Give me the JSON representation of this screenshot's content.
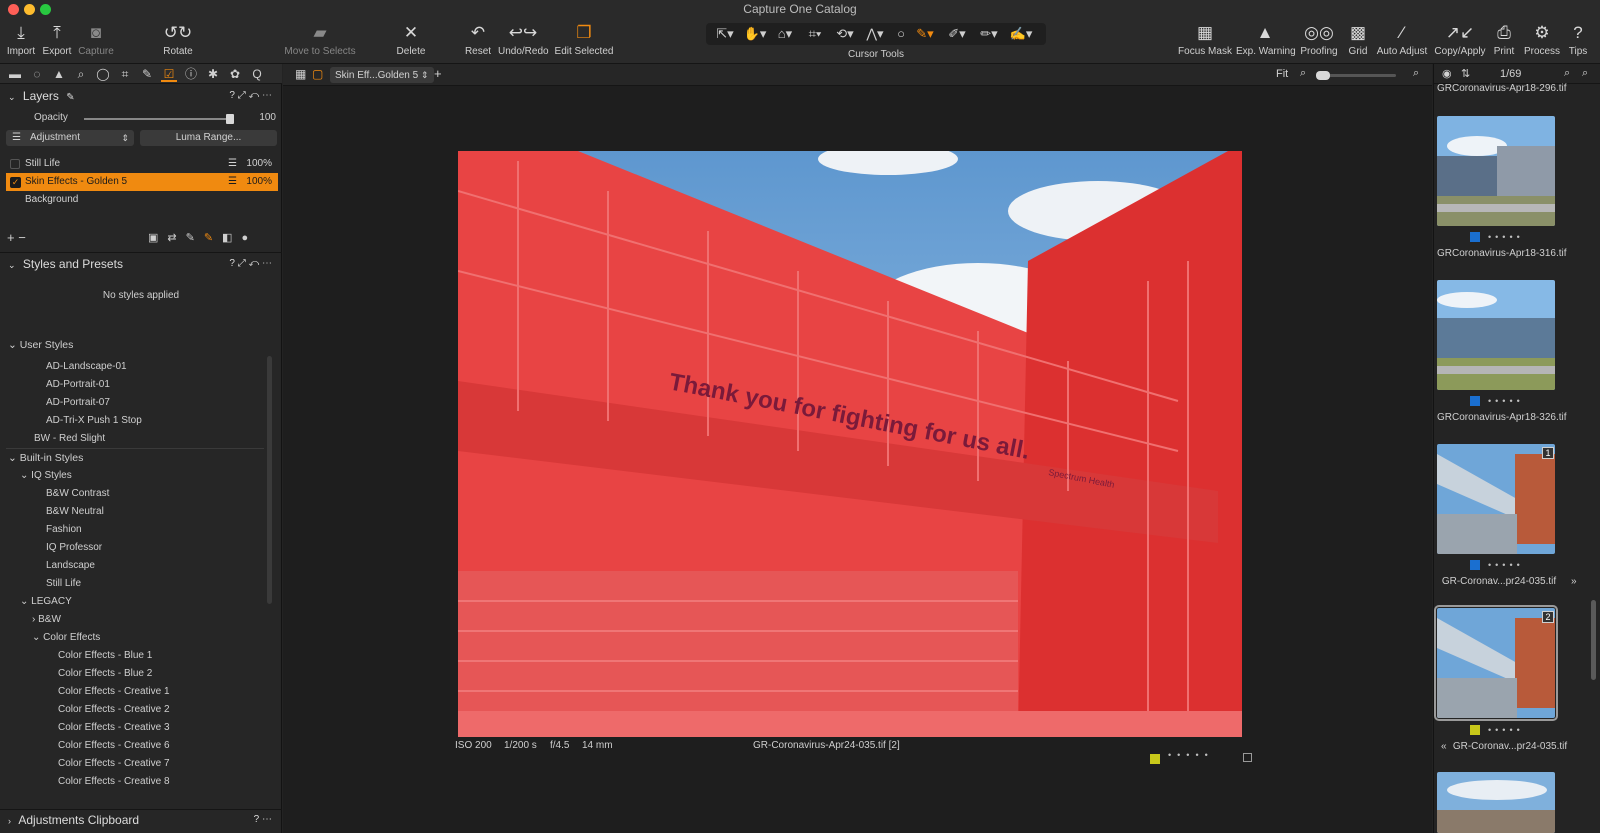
{
  "window": {
    "title": "Capture One Catalog"
  },
  "toolbar": {
    "import": "Import",
    "export": "Export",
    "capture": "Capture",
    "rotate": "Rotate",
    "move_to_selects": "Move to Selects",
    "delete": "Delete",
    "reset": "Reset",
    "undo_redo": "Undo/Redo",
    "edit_selected": "Edit Selected",
    "cursor_tools": "Cursor Tools",
    "focus_mask": "Focus Mask",
    "exp_warning": "Exp. Warning",
    "proofing": "Proofing",
    "grid": "Grid",
    "auto_adjust": "Auto Adjust",
    "copy_apply": "Copy/Apply",
    "print": "Print",
    "process": "Process",
    "tips": "Tips"
  },
  "layers": {
    "title": "Layers",
    "opacity_label": "Opacity",
    "opacity_value": "100",
    "opacity_fraction": 1.0,
    "mode": "Adjustment",
    "luma_button": "Luma Range...",
    "items": [
      {
        "name": "Still Life",
        "value": "100%"
      },
      {
        "name": "Skin Effects - Golden 5",
        "value": "100%"
      },
      {
        "name": "Background",
        "value": ""
      }
    ]
  },
  "styles": {
    "title": "Styles and Presets",
    "empty": "No styles applied",
    "user_styles": "User Styles",
    "user_items": [
      "AD-Landscape-01",
      "AD-Portrait-01",
      "AD-Portrait-07",
      "AD-Tri-X Push 1 Stop",
      "BW - Red Slight"
    ],
    "builtin": "Built-in Styles",
    "iq": "IQ Styles",
    "iq_items": [
      "B&W Contrast",
      "B&W Neutral",
      "Fashion",
      "IQ Professor",
      "Landscape",
      "Still Life"
    ],
    "legacy": "LEGACY",
    "bw": "B&W",
    "color_effects": "Color Effects",
    "color_items": [
      "Color Effects - Blue 1",
      "Color Effects - Blue 2",
      "Color Effects - Creative 1",
      "Color Effects - Creative 2",
      "Color Effects - Creative 3",
      "Color Effects - Creative 6",
      "Color Effects - Creative 7",
      "Color Effects - Creative 8"
    ]
  },
  "clipboard": {
    "title": "Adjustments Clipboard"
  },
  "viewer": {
    "tab": "Skin Eff...Golden 5",
    "fit": "Fit",
    "image_text": "Thank you for fighting for us all.",
    "sign_text": "Spectrum Health",
    "iso": "ISO 200",
    "shutter": "1/200 s",
    "aperture": "f/4.5",
    "focal": "14 mm",
    "filename": "GR-Coronavirus-Apr24-035.tif [2]"
  },
  "browser": {
    "count": "1/69",
    "top_file": "GRCoronavirus-Apr18-296.tif",
    "thumbs": [
      {
        "name": "GRCoronavirus-Apr18-316.tif",
        "label_color": "#1a6fd0",
        "badge": ""
      },
      {
        "name": "GRCoronavirus-Apr18-326.tif",
        "label_color": "#1a6fd0",
        "badge": ""
      },
      {
        "name": "GR-Coronav...pr24-035.tif",
        "label_color": "#1a6fd0",
        "badge": "1"
      },
      {
        "name": "GR-Coronav...pr24-035.tif",
        "label_color": "#c8c81a",
        "badge": "2"
      }
    ]
  },
  "colors": {
    "accent": "#f08a10",
    "mask_red": "#e83a3a",
    "label_yellow": "#c8c81a",
    "label_blue": "#1a6fd0"
  }
}
